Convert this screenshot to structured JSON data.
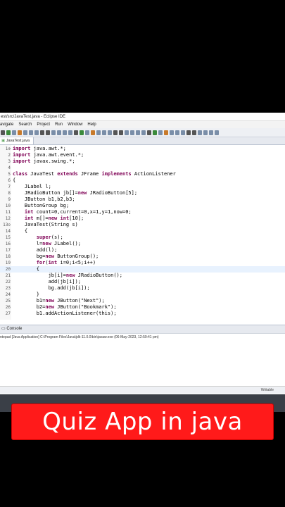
{
  "window": {
    "title": "est/src/JavaTest.java - Eclipse IDE"
  },
  "menu": [
    "avigate",
    "Search",
    "Project",
    "Run",
    "Window",
    "Help"
  ],
  "toolbar_icons": [
    "debug-icon",
    "run-icon",
    "search-icon",
    "external-tools-icon",
    "new-package-icon",
    "new-class-icon",
    "open-type-icon",
    "back-icon",
    "forward-icon",
    "pin-icon",
    "annotation-icon",
    "last-edit-icon",
    "navigate-icon"
  ],
  "editor": {
    "tab_label": "JavaTest.java",
    "lines": [
      {
        "n": "1⊕",
        "t": "import java.awt.*;"
      },
      {
        "n": "2",
        "t": "import java.awt.event.*;"
      },
      {
        "n": "3",
        "t": "import javax.swing.*;"
      },
      {
        "n": "4",
        "t": ""
      },
      {
        "n": "5",
        "t": "class JavaTest extends JFrame implements ActionListener"
      },
      {
        "n": "6",
        "t": "{"
      },
      {
        "n": "7",
        "t": "    JLabel l;"
      },
      {
        "n": "8",
        "t": "    JRadioButton jb[]=new JRadioButton[5];"
      },
      {
        "n": "9",
        "t": "    JButton b1,b2,b3;"
      },
      {
        "n": "10",
        "t": "    ButtonGroup bg;"
      },
      {
        "n": "11",
        "t": "    int count=0,current=0,x=1,y=1,now=0;"
      },
      {
        "n": "12",
        "t": "    int m[]=new int[10];"
      },
      {
        "n": "13⊖",
        "t": "    JavaTest(String s)"
      },
      {
        "n": "14",
        "t": "    {"
      },
      {
        "n": "15",
        "t": "        super(s);"
      },
      {
        "n": "16",
        "t": "        l=new JLabel();"
      },
      {
        "n": "17",
        "t": "        add(l);"
      },
      {
        "n": "18",
        "t": "        bg=new ButtonGroup();"
      },
      {
        "n": "19",
        "t": "        for(int i=0;i<5;i++)"
      },
      {
        "n": "20",
        "t": "        {"
      },
      {
        "n": "21",
        "t": "            jb[i]=new JRadioButton();"
      },
      {
        "n": "22",
        "t": "            add(jb[i]);"
      },
      {
        "n": "23",
        "t": "            bg.add(jb[i]);"
      },
      {
        "n": "24",
        "t": "        }"
      },
      {
        "n": "25",
        "t": "        b1=new JButton(\"Next\");"
      },
      {
        "n": "26",
        "t": "        b2=new JButton(\"Bookmark\");"
      },
      {
        "n": "27",
        "t": "        b1.addActionListener(this);"
      }
    ],
    "highlight_line": 20
  },
  "console": {
    "tab_label": "Console",
    "launch_info": "ntepad [Java Application] C:\\Program Files\\Java\\jdk-11.0.0\\bin\\javaw.exe (06-May-2023, 12:59:41 pm)"
  },
  "status": {
    "mode": "Writable"
  },
  "banner": {
    "text": "Quiz App in java"
  },
  "colors": {
    "banner_bg": "#ff1a1a",
    "keyword": "#7f0055",
    "line_highlight": "#e8f2fe"
  }
}
